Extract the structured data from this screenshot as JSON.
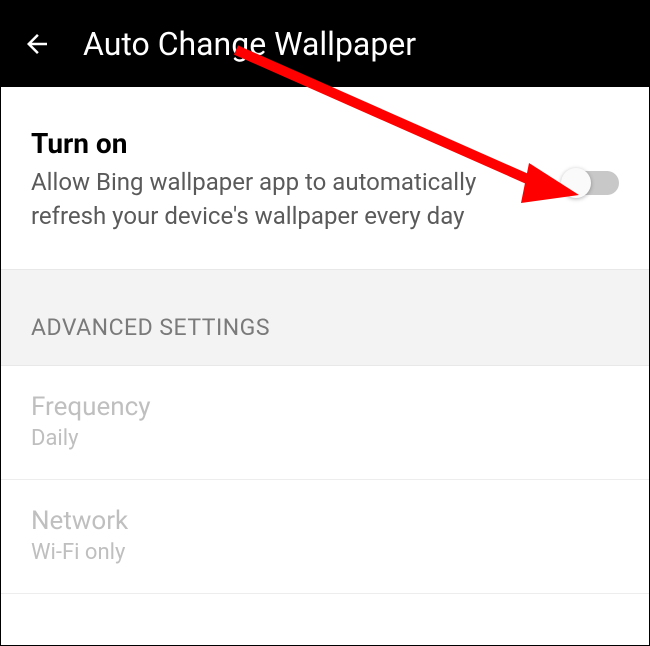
{
  "header": {
    "title": "Auto Change Wallpaper"
  },
  "turnOn": {
    "title": "Turn on",
    "description": "Allow Bing wallpaper app to automatically refresh your device's wallpaper every day"
  },
  "sectionHeader": {
    "title": "ADVANCED SETTINGS"
  },
  "settings": {
    "frequency": {
      "label": "Frequency",
      "value": "Daily"
    },
    "network": {
      "label": "Network",
      "value": "Wi-Fi only"
    }
  }
}
